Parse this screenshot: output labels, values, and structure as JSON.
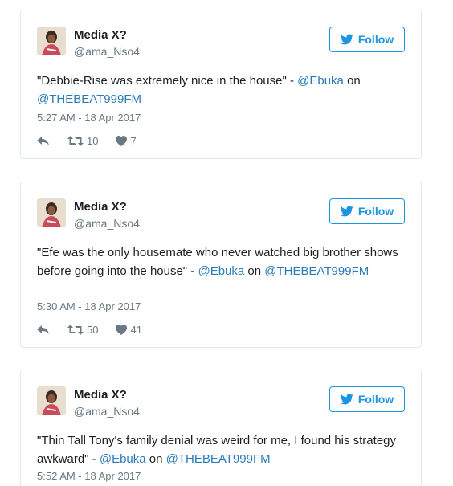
{
  "tweets": [
    {
      "author": {
        "name": "Media X?",
        "handle": "@ama_Nso4"
      },
      "follow_label": "Follow",
      "text_prefix": "\"Debbie-Rise was extremely nice in the house\" - ",
      "mention": "@Ebuka",
      "text_mid": " on ",
      "link2": "@THEBEAT999FM",
      "time": "5:27 AM - 18 Apr 2017",
      "retweets": "10",
      "likes": "7"
    },
    {
      "author": {
        "name": "Media X?",
        "handle": "@ama_Nso4"
      },
      "follow_label": "Follow",
      "text_prefix": "\"Efe was the only housemate who never watched big brother shows before going into the house\" - ",
      "mention": "@Ebuka",
      "text_mid": " on ",
      "link2": "@THEBEAT999FM",
      "time": "5:30 AM - 18 Apr 2017",
      "retweets": "50",
      "likes": "41"
    },
    {
      "author": {
        "name": "Media X?",
        "handle": "@ama_Nso4"
      },
      "follow_label": "Follow",
      "text_prefix": "\"Thin Tall Tony's family denial was weird for me, I found his strategy awkward\" - ",
      "mention": "@Ebuka",
      "text_mid": " on ",
      "link2": "@THEBEAT999FM",
      "time": "5:52 AM - 18 Apr 2017"
    }
  ],
  "colors": {
    "accent": "#1b95e0",
    "link": "#2b7bb9",
    "muted": "#697882",
    "border": "#e1e8ed"
  },
  "icons": [
    "twitter-bird-icon",
    "reply-icon",
    "retweet-icon",
    "heart-icon"
  ]
}
